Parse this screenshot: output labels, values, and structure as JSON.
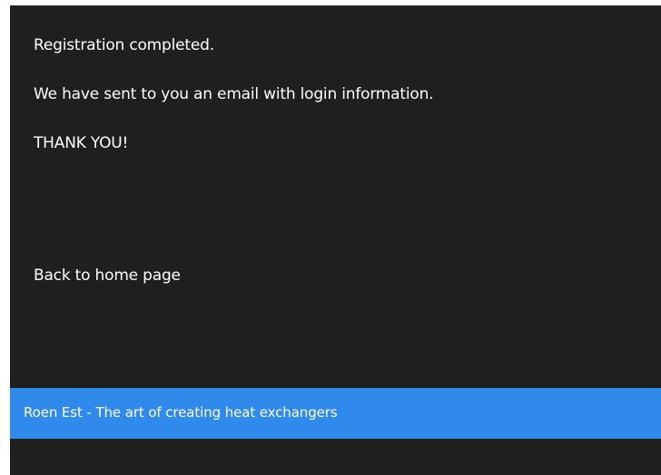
{
  "messages": {
    "line1": "Registration completed.",
    "line2": "We have sent to you an email with login information.",
    "line3": "THANK YOU!"
  },
  "links": {
    "home": "Back to home page"
  },
  "footer": {
    "text": "Roen Est - The art of creating heat exchangers"
  },
  "colors": {
    "panel_background": "#1f1f1f",
    "footer_background": "#2f8aeb",
    "text": "#ffffff"
  }
}
